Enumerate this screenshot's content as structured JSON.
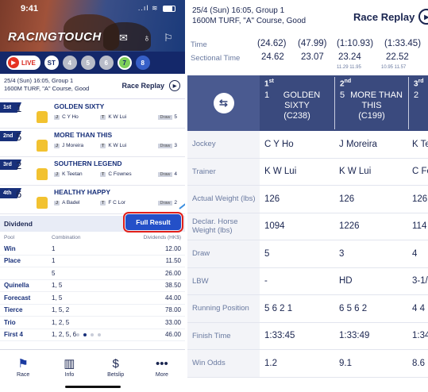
{
  "status": {
    "time": "9:41",
    "signal": "..ıl",
    "wifi": "≋"
  },
  "app": {
    "name": "RACINGTOUCH"
  },
  "races": {
    "live_label": "LIVE",
    "items": [
      "ST",
      "4",
      "5",
      "6",
      "7",
      "8"
    ],
    "selected": "7"
  },
  "race": {
    "line1": "25/4 (Sun) 16:05, Group 1",
    "line2": "1600M TURF, \"A\" Course, Good",
    "replay_label": "Race Replay"
  },
  "results": [
    {
      "place": "1st",
      "no": "1",
      "name": "GOLDEN SIXTY",
      "jockey": "C Y Ho",
      "trainer": "K W Lui",
      "draw": "5"
    },
    {
      "place": "2nd",
      "no": "5",
      "name": "MORE THAN THIS",
      "jockey": "J Moreira",
      "trainer": "K W Lui",
      "draw": "3"
    },
    {
      "place": "3rd",
      "no": "2",
      "name": "SOUTHERN LEGEND",
      "jockey": "K Teetan",
      "trainer": "C Fownes",
      "draw": "4"
    },
    {
      "place": "4th",
      "no": "6",
      "name": "HEALTHY HAPPY",
      "jockey": "A Badel",
      "trainer": "F C Lor",
      "draw": "2"
    }
  ],
  "labels": {
    "jockey_tag": "J",
    "trainer_tag": "T",
    "draw_tag": "Draw"
  },
  "dividend": {
    "title": "Dividend",
    "full_result_label": "Full Result",
    "columns": [
      "Pool",
      "Combination",
      "Dividends (HK$)"
    ],
    "rows": [
      {
        "pool": "Win",
        "combo": "1",
        "div": "12.00"
      },
      {
        "pool": "Place",
        "combo": "1",
        "div": "11.50"
      },
      {
        "pool": "",
        "combo": "5",
        "div": "26.00"
      },
      {
        "pool": "Quinella",
        "combo": "1, 5",
        "div": "38.50"
      },
      {
        "pool": "Forecast",
        "combo": "1, 5",
        "div": "44.00"
      },
      {
        "pool": "Tierce",
        "combo": "1, 5, 2",
        "div": "78.00"
      },
      {
        "pool": "Trio",
        "combo": "1, 2, 5",
        "div": "33.00"
      },
      {
        "pool": "First 4",
        "combo": "1, 2, 5, 6",
        "div": "46.00"
      }
    ]
  },
  "tabs": [
    {
      "label": "Race",
      "icon": "race-icon",
      "glyph": "⚑"
    },
    {
      "label": "Info",
      "icon": "info-icon",
      "glyph": "▥"
    },
    {
      "label": "Betslip",
      "icon": "betslip-icon",
      "glyph": "$"
    },
    {
      "label": "More",
      "icon": "more-icon",
      "glyph": "•••"
    }
  ],
  "detail": {
    "header_line1": "25/4 (Sun) 16:05, Group 1",
    "header_line2": "1600M TURF, \"A\" Course, Good",
    "replay_label": "Race Replay",
    "time_label": "Time",
    "times": [
      "(24.62)",
      "(47.99)",
      "(1:10.93)",
      "(1:33.45)"
    ],
    "sectional_label": "Sectional Time",
    "sectionals": [
      "24.62",
      "23.07",
      "23.24",
      "22.52"
    ],
    "splits": [
      "11.29  11.95",
      "10.95  11.57"
    ],
    "columns": [
      {
        "place": "1",
        "suffix": "st",
        "no": "1",
        "name": "GOLDEN SIXTY",
        "code": "(C238)"
      },
      {
        "place": "2",
        "suffix": "nd",
        "no": "5",
        "name": "MORE THAN THIS",
        "code": "(C199)"
      },
      {
        "place": "3",
        "suffix": "rd",
        "no": "2",
        "name": "",
        "code": ""
      }
    ],
    "rows": [
      {
        "label": "Jockey",
        "values": [
          "C Y Ho",
          "J Moreira",
          "K Te"
        ]
      },
      {
        "label": "Trainer",
        "values": [
          "K W Lui",
          "K W Lui",
          "C Fo"
        ]
      },
      {
        "label": "Actual Weight (lbs)",
        "values": [
          "126",
          "126",
          "126"
        ]
      },
      {
        "label": "Declar. Horse Weight (lbs)",
        "values": [
          "1094",
          "1226",
          "114"
        ]
      },
      {
        "label": "Draw",
        "values": [
          "5",
          "3",
          "4"
        ]
      },
      {
        "label": "LBW",
        "values": [
          "-",
          "HD",
          "3-1/"
        ]
      },
      {
        "label": "Running Position",
        "values": [
          "5 6 2 1",
          "6 5 6 2",
          "4 4"
        ]
      },
      {
        "label": "Finish Time",
        "values": [
          "1:33:45",
          "1:33:49",
          "1:34"
        ]
      },
      {
        "label": "Win Odds",
        "values": [
          "1.2",
          "9.1",
          "8.6"
        ]
      }
    ]
  },
  "colors": {
    "navy": "#14286a",
    "accent": "#2450c8",
    "live": "#e53222",
    "highlight": "#e1201a",
    "silk": "#f2c230"
  }
}
